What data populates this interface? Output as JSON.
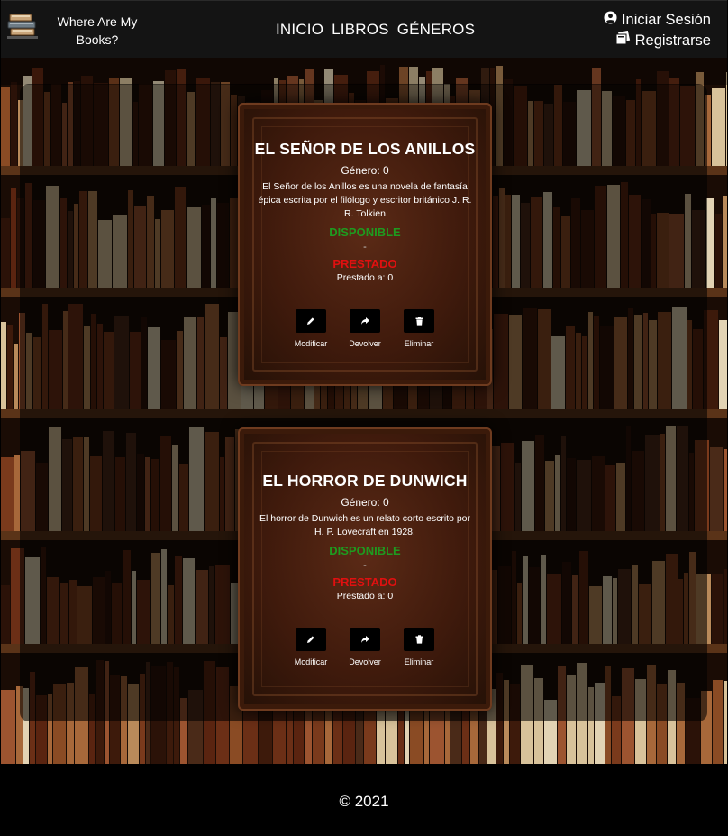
{
  "header": {
    "brand": "Where Are My Books?",
    "nav": [
      "INICIO",
      "LIBROS",
      "GÉNEROS"
    ],
    "login_label": "Iniciar Sesión",
    "register_label": "Registrarse"
  },
  "books": [
    {
      "title": "EL SEÑOR DE LOS ANILLOS",
      "genre": "Género: 0",
      "description": "El Señor de los Anillos es una novela de fantasía épica escrita por el filólogo y escritor británico J. R. R. Tolkien",
      "status_available": "DISPONIBLE",
      "separator": "-",
      "status_loaned": "PRESTADO",
      "loaned_to": "Prestado a: 0",
      "actions": {
        "edit": "Modificar",
        "return": "Devolver",
        "delete": "Eliminar"
      }
    },
    {
      "title": "EL HORROR DE DUNWICH",
      "genre": "Género: 0",
      "description": "El horror de Dunwich es un relato corto escrito por H. P. Lovecraft en 1928.",
      "status_available": "DISPONIBLE",
      "separator": "-",
      "status_loaned": "PRESTADO",
      "loaned_to": "Prestado a: 0",
      "actions": {
        "edit": "Modificar",
        "return": "Devolver",
        "delete": "Eliminar"
      }
    }
  ],
  "footer": {
    "copyright": "© 2021"
  },
  "colors": {
    "available": "#1f9a1f",
    "loaned": "#e01010",
    "header_bg": "#141414",
    "card_leather": "#4a1f0e"
  },
  "icons": {
    "logo": "book-stack-icon",
    "login": "user-circle-icon",
    "register": "books-icon",
    "edit": "pencil-icon",
    "return": "share-arrow-icon",
    "delete": "trash-icon"
  }
}
